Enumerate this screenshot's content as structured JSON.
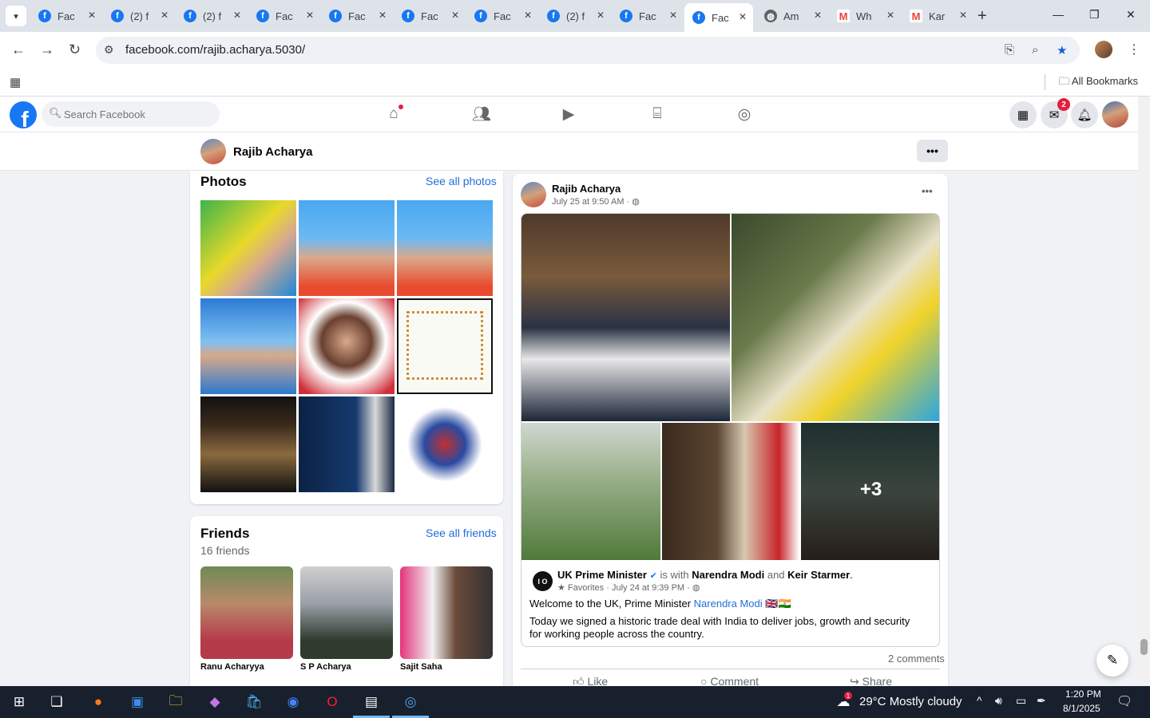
{
  "browser": {
    "tabs": [
      {
        "title": "Fac",
        "icon": "facebook-icon"
      },
      {
        "title": "(2) f",
        "icon": "facebook-icon"
      },
      {
        "title": "(2) f",
        "icon": "facebook-icon"
      },
      {
        "title": "Fac",
        "icon": "facebook-icon"
      },
      {
        "title": "Fac",
        "icon": "facebook-icon"
      },
      {
        "title": "Fac",
        "icon": "facebook-icon"
      },
      {
        "title": "Fac",
        "icon": "facebook-icon"
      },
      {
        "title": "(2) f",
        "icon": "facebook-icon"
      },
      {
        "title": "Fac",
        "icon": "facebook-icon"
      },
      {
        "title": "Fac",
        "icon": "facebook-icon"
      },
      {
        "title": "Am",
        "icon": "globe-icon"
      },
      {
        "title": "Wh",
        "icon": "gmail-icon"
      },
      {
        "title": "Kar",
        "icon": "gmail-icon"
      }
    ],
    "active_tab_index": 9,
    "url": "facebook.com/rajib.acharya.5030/",
    "all_bookmarks": "All Bookmarks"
  },
  "facebook": {
    "search_placeholder": "Search Facebook",
    "messenger_badge": "2",
    "profile_name": "Rajib Acharya",
    "photos": {
      "title": "Photos",
      "link": "See all photos"
    },
    "friends": {
      "title": "Friends",
      "link": "See all friends",
      "count": "16 friends",
      "items": [
        {
          "name": "Ranu Acharyya"
        },
        {
          "name": "S P Acharya"
        },
        {
          "name": "Sajit Saha"
        }
      ]
    },
    "post": {
      "author": "Rajib Acharya",
      "date": "July 25 at 9:50 AM",
      "more_photos": "+3",
      "shared": {
        "page_logo": "I O",
        "page": "UK Prime Minister",
        "with_text": "is with",
        "with_person_1": "Narendra Modi",
        "and_text": "and",
        "with_person_2": "Keir Starmer",
        "period": ".",
        "favorites": "Favorites",
        "date": "July 24 at 9:39 PM",
        "line1_prefix": "Welcome to the UK, Prime Minister",
        "line1_link": "Narendra Modi",
        "line1_flags": "🇬🇧🇮🇳",
        "line2": "Today we signed a historic trade deal with India to deliver jobs, growth and security for working people across the country."
      },
      "comments": "2 comments",
      "actions": {
        "like": "Like",
        "comment": "Comment",
        "share": "Share"
      }
    }
  },
  "taskbar": {
    "weather_temp": "29°C",
    "weather_desc": "Mostly cloudy",
    "weather_badge": "1",
    "time": "1:20 PM",
    "date": "8/1/2025"
  },
  "colors": {
    "facebook_blue": "#1877f2",
    "link_blue": "#216fdb",
    "notification_red": "#e41e3f",
    "taskbar": "#18202d"
  }
}
